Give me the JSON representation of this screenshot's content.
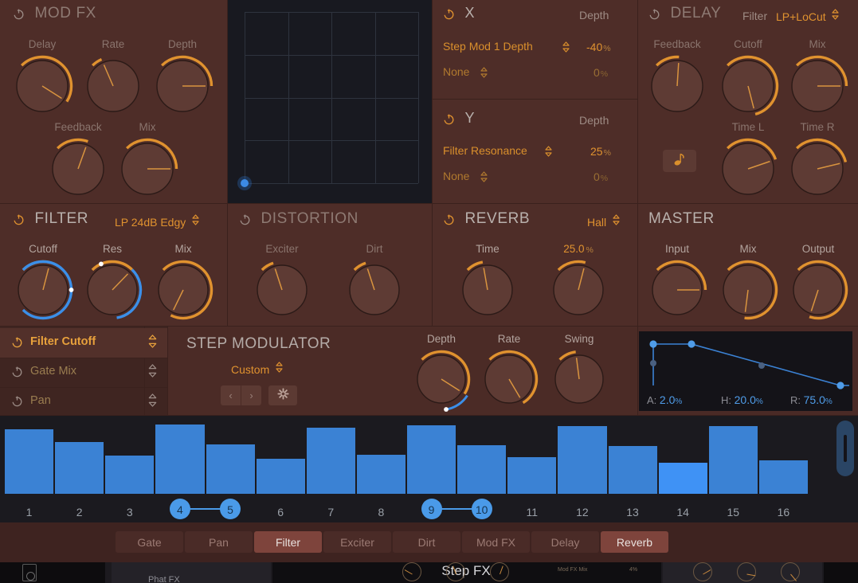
{
  "app": {
    "title": "Step FX",
    "bg_labels": [
      "Phat FX",
      "Mod FX Mix",
      "4%"
    ]
  },
  "colors": {
    "accent_orange": "#e0922f",
    "accent_blue": "#3b82d4",
    "panel_bg": "#4e2d28",
    "dark_bg": "#1b1a1f",
    "tab_active": "#7e443c"
  },
  "modfx": {
    "title": "MOD FX",
    "power": "off",
    "knobs": [
      {
        "label": "Delay",
        "value": 62
      },
      {
        "label": "Rate",
        "value": 8
      },
      {
        "label": "Depth",
        "value": 50
      },
      {
        "label": "Feedback",
        "value": 24
      },
      {
        "label": "Mix",
        "value": 50
      }
    ]
  },
  "xypad": {
    "grid_cols": 4,
    "grid_rows": 4,
    "puck_x": 0,
    "puck_y": 0
  },
  "xy": {
    "x": {
      "title": "X",
      "power": "on",
      "depth_header": "Depth",
      "rows": [
        {
          "target": "Step Mod 1 Depth",
          "depth": "-40",
          "unit": "%",
          "active": true
        },
        {
          "target": "None",
          "depth": "0",
          "unit": "%",
          "active": false
        }
      ]
    },
    "y": {
      "title": "Y",
      "power": "on",
      "depth_header": "Depth",
      "rows": [
        {
          "target": "Filter Resonance",
          "depth": "25",
          "unit": "%",
          "active": true
        },
        {
          "target": "None",
          "depth": "0",
          "unit": "%",
          "active": false
        }
      ]
    }
  },
  "delay": {
    "title": "DELAY",
    "power": "off",
    "filter_label": "Filter",
    "filter_value": "LP+LoCut",
    "sync_icon": "eighth-note-icon",
    "knobs": [
      {
        "label": "Feedback",
        "value": 18
      },
      {
        "label": "Cutoff",
        "value": 78
      },
      {
        "label": "Mix",
        "value": 50
      },
      {
        "label": "Time L",
        "value": 43
      },
      {
        "label": "Time R",
        "value": 45
      }
    ]
  },
  "filter": {
    "title": "FILTER",
    "power": "on",
    "type": "LP 24dB Edgy",
    "knobs": [
      {
        "label": "Cutoff",
        "value": 22,
        "mod": true,
        "mod_from": 50,
        "mod_color": "blue"
      },
      {
        "label": "Res",
        "value": 33,
        "mod": true,
        "mod_from": 8,
        "mod_color": "mixed"
      },
      {
        "label": "Mix",
        "value": 93,
        "mod": false
      }
    ]
  },
  "distortion": {
    "title": "DISTORTION",
    "power": "off",
    "knobs": [
      {
        "label": "Exciter",
        "value": 10
      },
      {
        "label": "Dirt",
        "value": 10
      }
    ]
  },
  "reverb": {
    "title": "REVERB",
    "power": "on",
    "type": "Hall",
    "mix_value": "25.0",
    "mix_unit": "%",
    "knobs": [
      {
        "label": "Time",
        "value": 13
      },
      {
        "label": "25.0",
        "value": 22
      }
    ]
  },
  "master": {
    "title": "MASTER",
    "knobs": [
      {
        "label": "Input",
        "value": 50
      },
      {
        "label": "Mix",
        "value": 86
      },
      {
        "label": "Output",
        "value": 90
      }
    ]
  },
  "mod_list": {
    "items": [
      {
        "label": "Filter Cutoff",
        "power": "on",
        "active": true
      },
      {
        "label": "Gate Mix",
        "power": "off",
        "active": false
      },
      {
        "label": "Pan",
        "power": "off",
        "active": false
      }
    ],
    "stepper_icon": "stepper-updown-icon"
  },
  "step_modulator": {
    "title": "STEP MODULATOR",
    "preset": "Custom",
    "prev_icon": "chevron-left-icon",
    "next_icon": "chevron-right-icon",
    "settings_icon": "gear-icon",
    "knobs": [
      {
        "label": "Depth",
        "value": 62,
        "mod": true
      },
      {
        "label": "Rate",
        "value": 72,
        "mod": false
      },
      {
        "label": "Swing",
        "value": 14,
        "mod": false
      }
    ]
  },
  "envelope": {
    "attack_label": "A:",
    "attack_value": "2.0",
    "attack_unit": "%",
    "hold_label": "H:",
    "hold_value": "20.0",
    "hold_unit": "%",
    "release_label": "R:",
    "release_value": "75.0",
    "release_unit": "%"
  },
  "sequencer": {
    "steps": [
      {
        "n": "1",
        "value": 88,
        "tie": false,
        "playing": false
      },
      {
        "n": "2",
        "value": 71,
        "tie": false,
        "playing": false
      },
      {
        "n": "3",
        "value": 52,
        "tie": false,
        "playing": false
      },
      {
        "n": "4",
        "value": 95,
        "tie": true,
        "playing": false
      },
      {
        "n": "5",
        "value": 67,
        "tie": true,
        "playing": false
      },
      {
        "n": "6",
        "value": 48,
        "tie": false,
        "playing": false
      },
      {
        "n": "7",
        "value": 90,
        "tie": false,
        "playing": false
      },
      {
        "n": "8",
        "value": 53,
        "tie": false,
        "playing": false
      },
      {
        "n": "9",
        "value": 94,
        "tie": true,
        "playing": false
      },
      {
        "n": "10",
        "value": 66,
        "tie": true,
        "playing": false
      },
      {
        "n": "11",
        "value": 50,
        "tie": false,
        "playing": false
      },
      {
        "n": "12",
        "value": 92,
        "tie": false,
        "playing": false
      },
      {
        "n": "13",
        "value": 65,
        "tie": false,
        "playing": false
      },
      {
        "n": "14",
        "value": 42,
        "tie": false,
        "playing": true
      },
      {
        "n": "15",
        "value": 92,
        "tie": false,
        "playing": false
      },
      {
        "n": "16",
        "value": 46,
        "tie": false,
        "playing": false
      }
    ],
    "ties": [
      [
        4,
        5
      ],
      [
        9,
        10
      ]
    ],
    "scroll_handle": "seq-scroll-handle"
  },
  "tabs": [
    {
      "label": "Gate",
      "active": false
    },
    {
      "label": "Pan",
      "active": false
    },
    {
      "label": "Filter",
      "active": true
    },
    {
      "label": "Exciter",
      "active": false
    },
    {
      "label": "Dirt",
      "active": false
    },
    {
      "label": "Mod FX",
      "active": false
    },
    {
      "label": "Delay",
      "active": false
    },
    {
      "label": "Reverb",
      "active": true
    }
  ]
}
